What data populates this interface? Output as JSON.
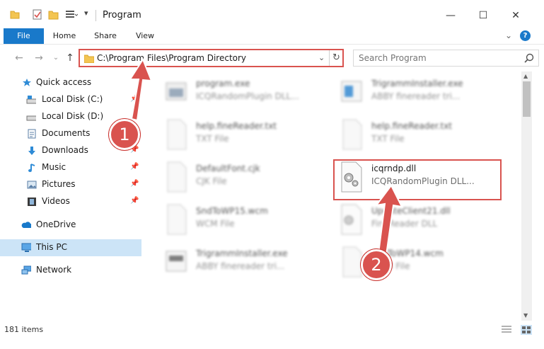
{
  "window": {
    "title": "Program",
    "minimize": "—",
    "maximize": "☐",
    "close": "✕"
  },
  "ribbon": {
    "tabs": [
      {
        "label": "File"
      },
      {
        "label": "Home"
      },
      {
        "label": "Share"
      },
      {
        "label": "View"
      }
    ],
    "expand": "⌄",
    "help": "?"
  },
  "nav": {
    "back": "←",
    "forward": "→",
    "recent": "⌄",
    "up": "↑"
  },
  "address": {
    "path": "C:\\Program Files\\Program Directory",
    "dropdown": "⌄",
    "refresh": "↻"
  },
  "search": {
    "placeholder": "Search Program"
  },
  "sidebar": {
    "items": [
      {
        "label": "Quick access",
        "pinned": false
      },
      {
        "label": "Local Disk (C:)",
        "pinned": true
      },
      {
        "label": "Local Disk (D:)",
        "pinned": true
      },
      {
        "label": "Documents",
        "pinned": true
      },
      {
        "label": "Downloads",
        "pinned": true
      },
      {
        "label": "Music",
        "pinned": true
      },
      {
        "label": "Pictures",
        "pinned": true
      },
      {
        "label": "Videos",
        "pinned": true
      },
      {
        "label": "OneDrive",
        "pinned": false
      },
      {
        "label": "This PC",
        "pinned": false,
        "selected": true
      },
      {
        "label": "Network",
        "pinned": false
      }
    ],
    "pin_glyph": "📌"
  },
  "files": [
    {
      "name": "program.exe",
      "type": "ICQRandomPlugin DLL...",
      "icon": "exe-icon"
    },
    {
      "name": "TrigrammInstaller.exe",
      "type": "ABBY finereader tri...",
      "icon": "installer-icon"
    },
    {
      "name": "help.fineReader.txt",
      "type": "TXT File",
      "icon": "text-file-icon"
    },
    {
      "name": "help.fineReader.txt",
      "type": "TXT File",
      "icon": "text-file-icon"
    },
    {
      "name": "DefaultFont.cjk",
      "type": "CJK File",
      "icon": "blank-file-icon"
    },
    {
      "name": "icqrndp.dll",
      "type": "ICQRandomPlugin DLL...",
      "icon": "dll-gear-icon"
    },
    {
      "name": "SndToWP15.wcm",
      "type": "WCM File",
      "icon": "blank-file-icon"
    },
    {
      "name": "UpdateClient21.dll",
      "type": "FineReader DLL",
      "icon": "dll-gear-icon"
    },
    {
      "name": "TrigrammInstaller.exe",
      "type": "ABBY finereader tri...",
      "icon": "installer-icon"
    },
    {
      "name": "SndToWP14.wcm",
      "type": "WCM File",
      "icon": "blank-file-icon"
    }
  ],
  "status": {
    "count": "181 items"
  },
  "callouts": {
    "one": "1",
    "two": "2"
  },
  "colors": {
    "accent": "#1979ca",
    "highlight": "#d9534f",
    "selected_nav": "#cce4f7"
  }
}
